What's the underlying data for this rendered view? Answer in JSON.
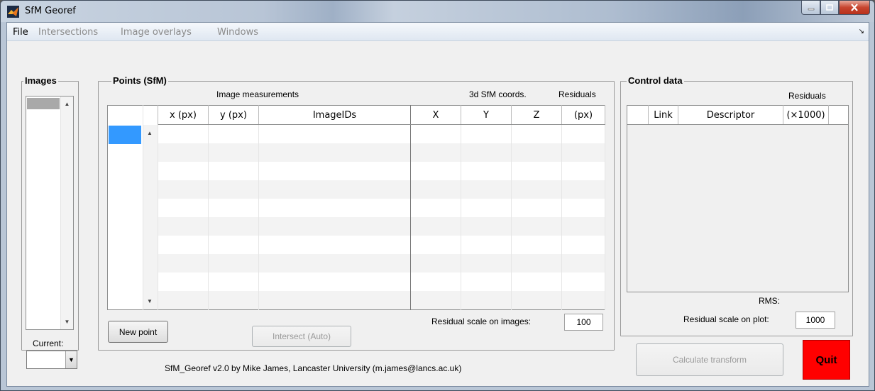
{
  "window": {
    "title": "SfM Georef"
  },
  "menu": [
    {
      "label": "File",
      "active": true
    },
    {
      "label": "Intersections",
      "active": false
    },
    {
      "label": "Image overlays",
      "active": false
    },
    {
      "label": "Windows",
      "active": false
    }
  ],
  "images_panel": {
    "title": "Images",
    "current_label": "Current:"
  },
  "points_panel": {
    "title": "Points (SfM)",
    "group_image": "Image measurements",
    "group_coords": "3d SfM coords.",
    "group_residuals": "Residuals",
    "columns": [
      "x (px)",
      "y (px)",
      "ImageIDs",
      "X",
      "Y",
      "Z",
      "(px)"
    ],
    "residual_scale_label": "Residual scale on images:",
    "residual_scale_value": "100",
    "new_point_button": "New point",
    "intersect_button": "Intersect (Auto)"
  },
  "control_panel": {
    "title": "Control data",
    "residuals_header": "Residuals",
    "columns": [
      "Link",
      "Descriptor",
      "(×1000)"
    ],
    "rms_label": "RMS:",
    "residual_scale_label": "Residual scale on plot:",
    "residual_scale_value": "1000"
  },
  "footer": {
    "credit": "SfM_Georef v2.0 by Mike James, Lancaster University (m.james@lancs.ac.uk)",
    "calculate_button": "Calculate transform",
    "quit_button": "Quit"
  },
  "colors": {
    "quit": "#ff0000",
    "selection": "#3399ff"
  }
}
